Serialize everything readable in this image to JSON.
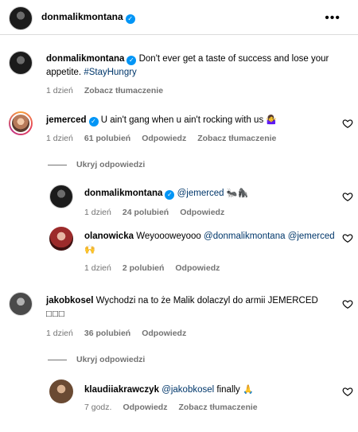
{
  "header": {
    "username": "donmalikmontana",
    "more_icon": "more-horizontal-icon"
  },
  "caption": {
    "username": "donmalikmontana",
    "text": "Don't ever get a taste of success and lose your appetite.",
    "hashtag": "#StayHungry",
    "time": "1 dzień",
    "translate": "Zobacz tłumaczenie"
  },
  "comments": [
    {
      "username": "jemerced",
      "text": "U ain't gang when u ain't rocking with us",
      "emoji": "🤷‍♀️",
      "time": "1 dzień",
      "likes": "61 polubień",
      "reply": "Odpowiedz",
      "translate": "Zobacz tłumaczenie",
      "hide_replies": "Ukryj odpowiedzi",
      "replies": [
        {
          "username": "donmalikmontana",
          "mention": "@jemerced",
          "emoji": "🐜🦍",
          "time": "1 dzień",
          "likes": "24 polubień",
          "reply": "Odpowiedz"
        },
        {
          "username": "olanowicka",
          "text": "Weyoooweyooo",
          "mention1": "@donmalikmontana",
          "mention2": "@jemerced",
          "emoji": "🙌",
          "time": "1 dzień",
          "likes": "2 polubień",
          "reply": "Odpowiedz"
        }
      ]
    },
    {
      "username": "jakobkosel",
      "text": "Wychodzi na to że Malik dolaczyl do armii JEMERCED",
      "boxes": "□□□",
      "time": "1 dzień",
      "likes": "36 polubień",
      "reply": "Odpowiedz",
      "hide_replies": "Ukryj odpowiedzi",
      "replies": [
        {
          "username": "klaudiiakrawczyk",
          "mention": "@jakobkosel",
          "text": "finally",
          "emoji": "🙏",
          "time": "7 godz.",
          "reply": "Odpowiedz",
          "translate": "Zobacz tłumaczenie"
        }
      ]
    }
  ]
}
